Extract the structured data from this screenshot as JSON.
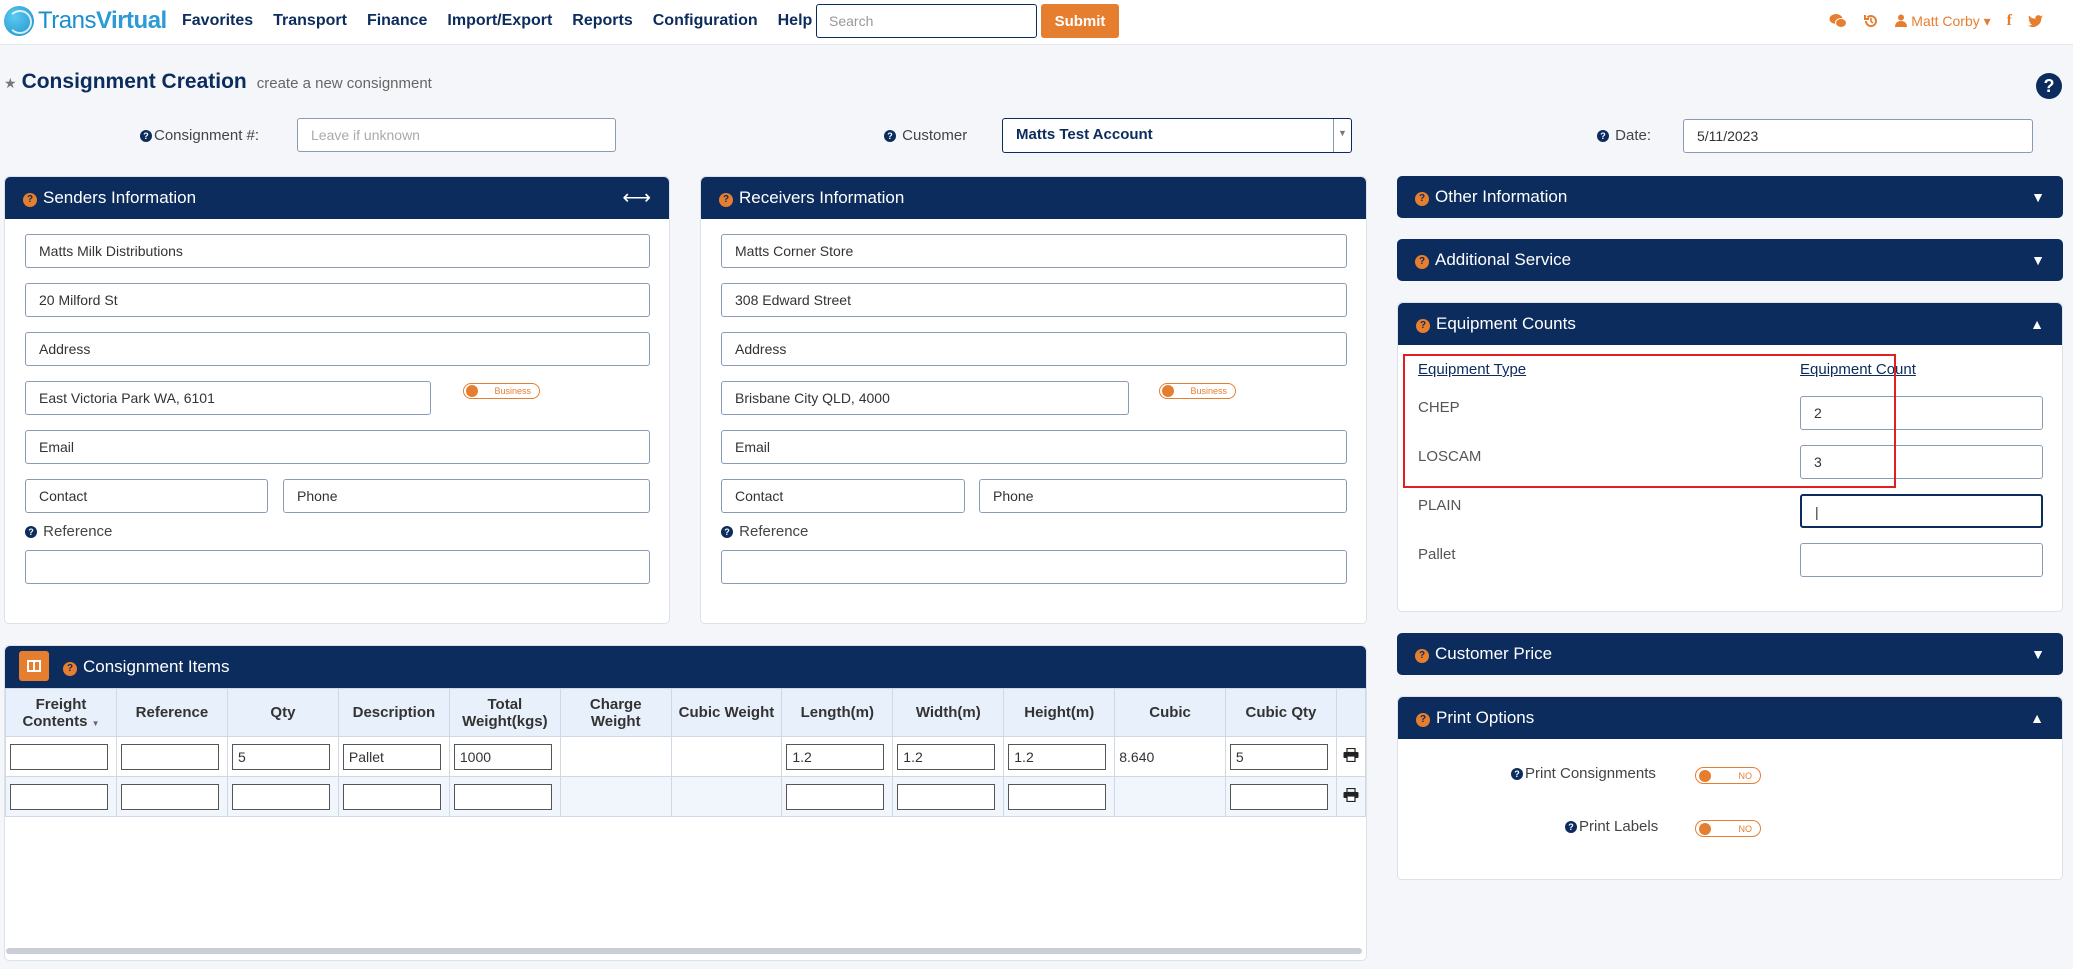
{
  "brand": {
    "name_a": "Trans",
    "name_b": "Virtual"
  },
  "nav": [
    "Favorites",
    "Transport",
    "Finance",
    "Import/Export",
    "Reports",
    "Configuration",
    "Help"
  ],
  "search": {
    "placeholder": "Search"
  },
  "submit_label": "Submit",
  "user": {
    "name": "Matt Corby"
  },
  "page": {
    "title": "Consignment Creation",
    "subtitle": "create a new consignment"
  },
  "header_fields": {
    "consignment_label": "Consignment #:",
    "consignment_placeholder": "Leave if unknown",
    "customer_label": "Customer",
    "customer_value": "Matts Test Account",
    "date_label": "Date:",
    "date_value": "5/11/2023"
  },
  "senders": {
    "title": "Senders Information",
    "name": "Matts Milk Distributions",
    "street": "20 Milford St",
    "address": "Address",
    "suburb": "East Victoria Park WA, 6101",
    "business": "Business",
    "email": "Email",
    "contact": "Contact",
    "phone": "Phone",
    "reference_label": "Reference",
    "reference_value": ""
  },
  "receivers": {
    "title": "Receivers Information",
    "name": "Matts Corner Store",
    "street": "308 Edward Street",
    "address": "Address",
    "suburb": "Brisbane City QLD, 4000",
    "business": "Business",
    "email": "Email",
    "contact": "Contact",
    "phone": "Phone",
    "reference_label": "Reference",
    "reference_value": ""
  },
  "right_panels": {
    "other": "Other Information",
    "additional": "Additional Service",
    "equipment": "Equipment Counts",
    "customer_price": "Customer Price",
    "print_options": "Print Options"
  },
  "equipment": {
    "type_header": "Equipment Type",
    "count_header": "Equipment Count",
    "rows": [
      {
        "type": "CHEP",
        "count": "2"
      },
      {
        "type": "LOSCAM",
        "count": "3"
      },
      {
        "type": "PLAIN",
        "count": "|"
      },
      {
        "type": "Pallet",
        "count": ""
      }
    ]
  },
  "print": {
    "consignments_label": "Print Consignments",
    "labels_label": "Print Labels",
    "consignments_value": "NO",
    "labels_value": "NO"
  },
  "items": {
    "title": "Consignment Items",
    "columns": [
      "Freight Contents",
      "Reference",
      "Qty",
      "Description",
      "Total Weight(kgs)",
      "Charge Weight",
      "Cubic Weight",
      "Length(m)",
      "Width(m)",
      "Height(m)",
      "Cubic",
      "Cubic Qty"
    ],
    "rows": [
      {
        "freight": "",
        "reference": "",
        "qty": "5",
        "description": "Pallet",
        "weight": "1000",
        "charge": "",
        "cubic_weight": "",
        "length": "1.2",
        "width": "1.2",
        "height": "1.2",
        "cubic": "8.640",
        "cubic_qty": "5"
      },
      {
        "freight": "",
        "reference": "",
        "qty": "",
        "description": "",
        "weight": "",
        "charge": "",
        "cubic_weight": "",
        "length": "",
        "width": "",
        "height": "",
        "cubic": "",
        "cubic_qty": ""
      }
    ]
  },
  "colors": {
    "navy": "#0b2c5c",
    "orange": "#e67e30",
    "highlight": "#e02020"
  }
}
